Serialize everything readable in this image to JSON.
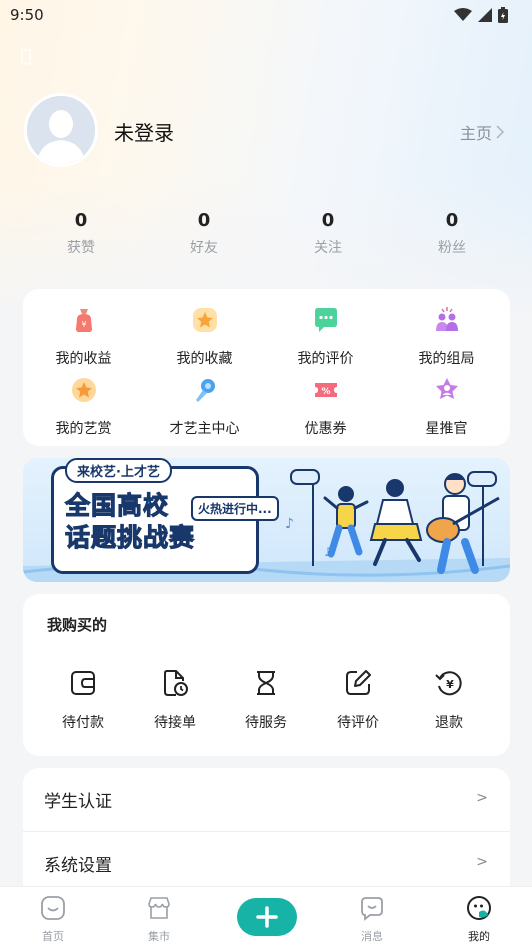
{
  "status_bar": {
    "time": "9:50"
  },
  "profile": {
    "name": "未登录",
    "home_link": "主页"
  },
  "stats": [
    {
      "value": "0",
      "label": "获赞"
    },
    {
      "value": "0",
      "label": "好友"
    },
    {
      "value": "0",
      "label": "关注"
    },
    {
      "value": "0",
      "label": "粉丝"
    }
  ],
  "features": [
    {
      "label": "我的收益",
      "icon": "money-bag-icon"
    },
    {
      "label": "我的收藏",
      "icon": "star-icon"
    },
    {
      "label": "我的评价",
      "icon": "comment-icon"
    },
    {
      "label": "我的组局",
      "icon": "group-icon"
    },
    {
      "label": "我的艺赏",
      "icon": "star-badge-icon"
    },
    {
      "label": "才艺主中心",
      "icon": "microphone-icon"
    },
    {
      "label": "优惠券",
      "icon": "coupon-icon"
    },
    {
      "label": "星推官",
      "icon": "star-person-icon"
    }
  ],
  "banner": {
    "tag": "来校艺·上才艺",
    "title_line1": "全国高校",
    "title_line2": "话题挑战赛",
    "badge": "火热进行中..."
  },
  "orders": {
    "title": "我购买的",
    "items": [
      {
        "label": "待付款",
        "icon": "wallet-icon"
      },
      {
        "label": "待接单",
        "icon": "document-clock-icon"
      },
      {
        "label": "待服务",
        "icon": "hourglass-icon"
      },
      {
        "label": "待评价",
        "icon": "edit-icon"
      },
      {
        "label": "退款",
        "icon": "refund-icon"
      }
    ]
  },
  "settings": [
    {
      "label": "学生认证",
      "arrow": ">"
    },
    {
      "label": "系统设置",
      "arrow": ">"
    }
  ],
  "tabbar": {
    "items": [
      {
        "label": "首页",
        "icon": "home-icon"
      },
      {
        "label": "集市",
        "icon": "market-icon"
      },
      {
        "label": "消息",
        "icon": "message-icon"
      },
      {
        "label": "我的",
        "icon": "profile-icon"
      }
    ],
    "active": "我的",
    "accent": "#17b3a6"
  },
  "colors": {
    "accent": "#17b3a6",
    "banner_text": "#2a83e6",
    "banner_outline": "#18376b"
  }
}
